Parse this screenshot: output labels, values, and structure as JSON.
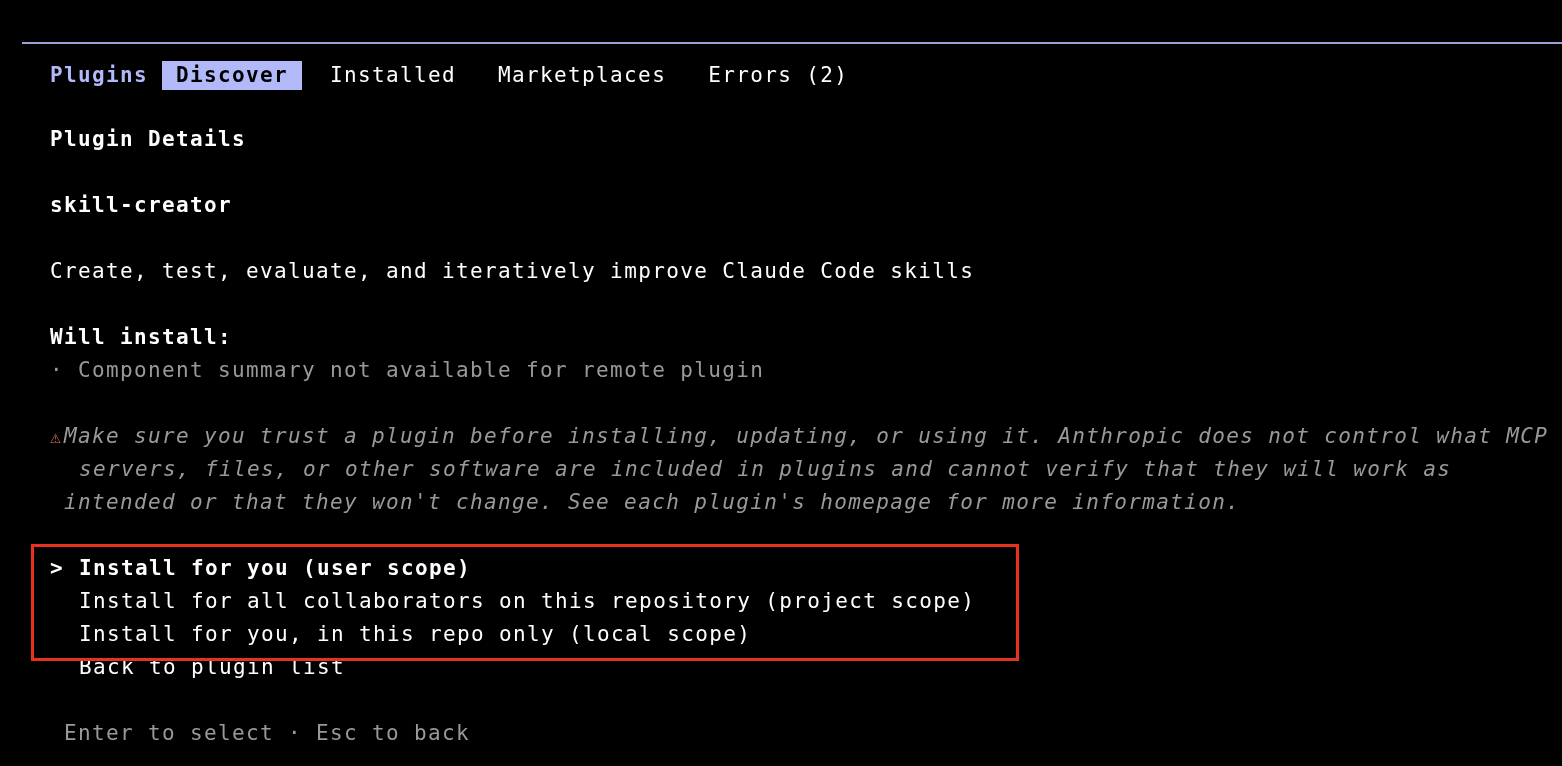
{
  "header": {
    "title": "Plugins"
  },
  "tabs": [
    {
      "label": "Discover",
      "selected": true
    },
    {
      "label": "Installed",
      "selected": false
    },
    {
      "label": "Marketplaces",
      "selected": false
    },
    {
      "label": "Errors (2)",
      "selected": false
    }
  ],
  "section_title": "Plugin Details",
  "plugin": {
    "name": "skill-creator",
    "description": "Create, test, evaluate, and iteratively improve Claude Code skills"
  },
  "will_install": {
    "heading": "Will install:",
    "items": [
      "· Component summary not available for remote plugin"
    ]
  },
  "warning": {
    "icon": "⚠",
    "lines": [
      "Make sure you trust a plugin before installing, updating, or using it. Anthropic does not control what MCP",
      "servers, files, or other software are included in plugins and cannot verify that they will work as",
      "intended or that they won't change. See each plugin's homepage for more information."
    ]
  },
  "highlight_frame": {
    "color": "#e8321e",
    "options": [
      {
        "label": "Install for you (user scope)",
        "selected": true
      },
      {
        "label": "Install for all collaborators on this repository (project scope)",
        "selected": false
      },
      {
        "label": "Install for you, in this repo only (local scope)",
        "selected": false
      }
    ]
  },
  "options": [
    {
      "label": "Back to plugin list",
      "selected": false
    }
  ],
  "pointer": ">",
  "footer": "Enter to select · Esc to back"
}
